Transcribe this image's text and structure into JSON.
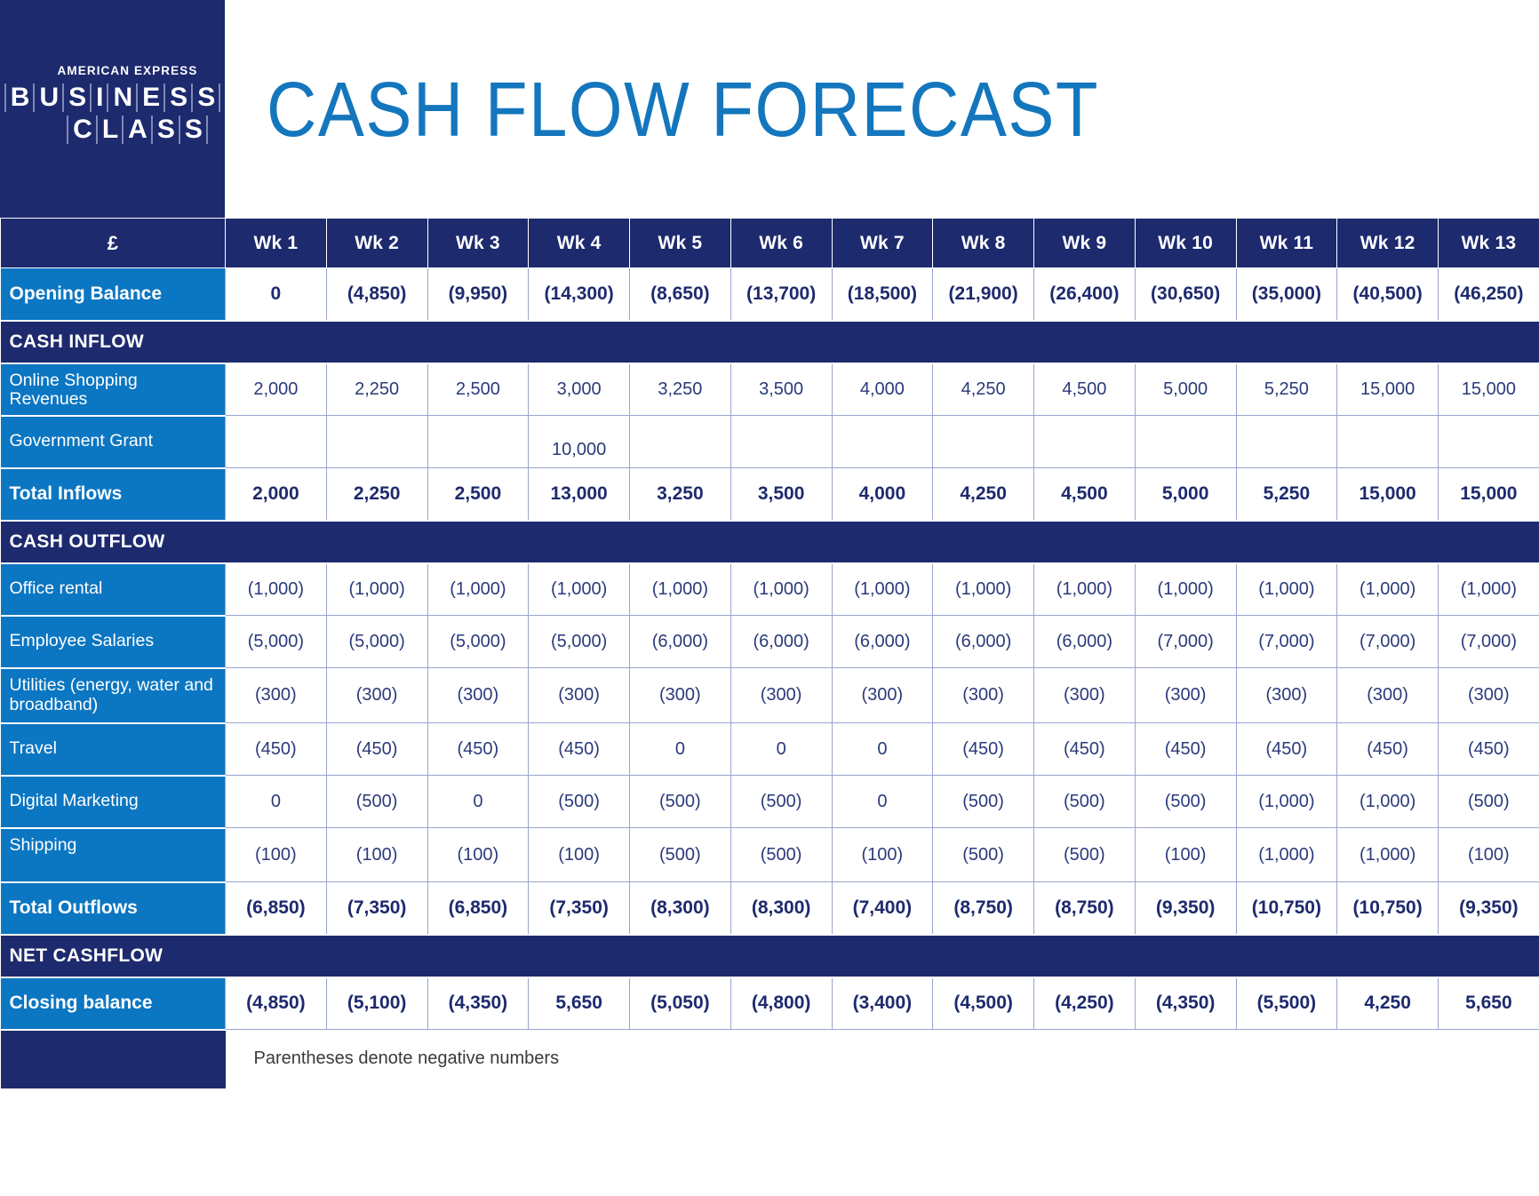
{
  "brand": {
    "amex_label": "AMERICAN EXPRESS",
    "business_letters": [
      "B",
      "U",
      "S",
      "I",
      "N",
      "E",
      "S",
      "S"
    ],
    "class_letters": [
      "C",
      "L",
      "A",
      "S",
      "S"
    ],
    "navy": "#1d2a6e",
    "blue": "#0b76c2",
    "title_blue": "#1476bd"
  },
  "header": {
    "title": "CASH FLOW FORECAST"
  },
  "table": {
    "corner_label": "£",
    "columns": [
      "Wk 1",
      "Wk 2",
      "Wk 3",
      "Wk 4",
      "Wk 5",
      "Wk 6",
      "Wk 7",
      "Wk 8",
      "Wk 9",
      "Wk 10",
      "Wk 11",
      "Wk 12",
      "Wk 13"
    ],
    "opening": {
      "label": "Opening Balance",
      "values": [
        "0",
        "(4,850)",
        "(9,950)",
        "(14,300)",
        "(8,650)",
        "(13,700)",
        "(18,500)",
        "(21,900)",
        "(26,400)",
        "(30,650)",
        "(35,000)",
        "(40,500)",
        "(46,250)"
      ]
    },
    "section_inflow": "CASH INFLOW",
    "inflow_rows": [
      {
        "label": "Online Shopping Revenues",
        "values": [
          "2,000",
          "2,250",
          "2,500",
          "3,000",
          "3,250",
          "3,500",
          "4,000",
          "4,250",
          "4,500",
          "5,000",
          "5,250",
          "15,000",
          "15,000"
        ]
      },
      {
        "label": "Government Grant",
        "values": [
          "",
          "",
          "",
          "10,000",
          "",
          "",
          "",
          "",
          "",
          "",
          "",
          "",
          ""
        ]
      }
    ],
    "total_inflows": {
      "label": "Total Inflows",
      "values": [
        "2,000",
        "2,250",
        "2,500",
        "13,000",
        "3,250",
        "3,500",
        "4,000",
        "4,250",
        "4,500",
        "5,000",
        "5,250",
        "15,000",
        "15,000"
      ]
    },
    "section_outflow": "CASH OUTFLOW",
    "outflow_rows": [
      {
        "label": "Office rental",
        "values": [
          "(1,000)",
          "(1,000)",
          "(1,000)",
          "(1,000)",
          "(1,000)",
          "(1,000)",
          "(1,000)",
          "(1,000)",
          "(1,000)",
          "(1,000)",
          "(1,000)",
          "(1,000)",
          "(1,000)"
        ]
      },
      {
        "label": "Employee Salaries",
        "values": [
          "(5,000)",
          "(5,000)",
          "(5,000)",
          "(5,000)",
          "(6,000)",
          "(6,000)",
          "(6,000)",
          "(6,000)",
          "(6,000)",
          "(7,000)",
          "(7,000)",
          "(7,000)",
          "(7,000)"
        ]
      },
      {
        "label": "Utilities (energy, water and broadband)",
        "values": [
          "(300)",
          "(300)",
          "(300)",
          "(300)",
          "(300)",
          "(300)",
          "(300)",
          "(300)",
          "(300)",
          "(300)",
          "(300)",
          "(300)",
          "(300)"
        ]
      },
      {
        "label": "Travel",
        "values": [
          "(450)",
          "(450)",
          "(450)",
          "(450)",
          "0",
          "0",
          "0",
          "(450)",
          "(450)",
          "(450)",
          "(450)",
          "(450)",
          "(450)"
        ]
      },
      {
        "label": "Digital Marketing",
        "values": [
          "0",
          "(500)",
          "0",
          "(500)",
          "(500)",
          "(500)",
          "0",
          "(500)",
          "(500)",
          "(500)",
          "(1,000)",
          "(1,000)",
          "(500)"
        ]
      },
      {
        "label": "Shipping",
        "values": [
          "(100)",
          "(100)",
          "(100)",
          "(100)",
          "(500)",
          "(500)",
          "(100)",
          "(500)",
          "(500)",
          "(100)",
          "(1,000)",
          "(1,000)",
          "(100)"
        ]
      }
    ],
    "total_outflows": {
      "label": "Total Outflows",
      "values": [
        "(6,850)",
        "(7,350)",
        "(6,850)",
        "(7,350)",
        "(8,300)",
        "(8,300)",
        "(7,400)",
        "(8,750)",
        "(8,750)",
        "(9,350)",
        "(10,750)",
        "(10,750)",
        "(9,350)"
      ]
    },
    "section_net": "NET CASHFLOW",
    "closing": {
      "label": "Closing balance",
      "values": [
        "(4,850)",
        "(5,100)",
        "(4,350)",
        "5,650",
        "(5,050)",
        "(4,800)",
        "(3,400)",
        "(4,500)",
        "(4,250)",
        "(4,350)",
        "(5,500)",
        "4,250",
        "5,650"
      ]
    },
    "footnote": "Parentheses denote negative numbers"
  }
}
